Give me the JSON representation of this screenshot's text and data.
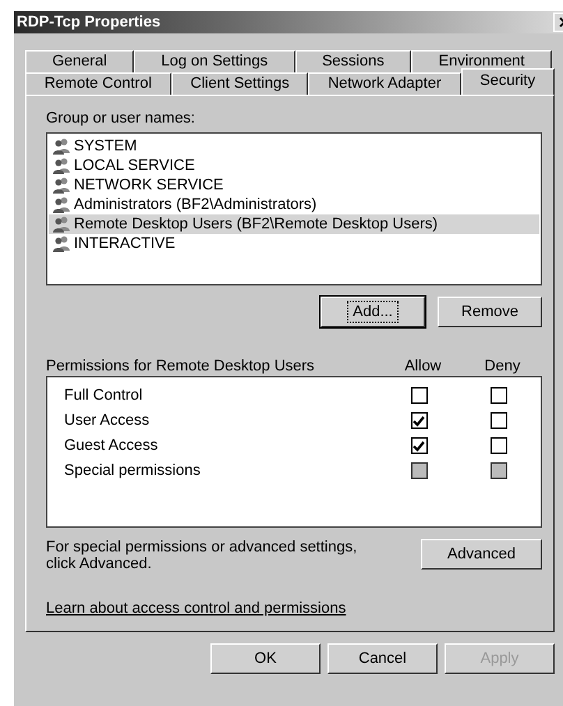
{
  "window": {
    "title": "RDP-Tcp Properties"
  },
  "tab_rows": [
    [
      {
        "label": "General",
        "selected": false
      },
      {
        "label": "Log on Settings",
        "selected": false
      },
      {
        "label": "Sessions",
        "selected": false
      },
      {
        "label": "Environment",
        "selected": false
      }
    ],
    [
      {
        "label": "Remote Control",
        "selected": false
      },
      {
        "label": "Client Settings",
        "selected": false
      },
      {
        "label": "Network Adapter",
        "selected": false
      },
      {
        "label": "Security",
        "selected": true
      }
    ]
  ],
  "groups": {
    "label": "Group or user names:",
    "items": [
      {
        "name": "SYSTEM",
        "selected": false
      },
      {
        "name": "LOCAL SERVICE",
        "selected": false
      },
      {
        "name": "NETWORK SERVICE",
        "selected": false
      },
      {
        "name": "Administrators (BF2\\Administrators)",
        "selected": false
      },
      {
        "name": "Remote Desktop Users (BF2\\Remote Desktop Users)",
        "selected": true
      },
      {
        "name": "INTERACTIVE",
        "selected": false
      }
    ],
    "buttons": [
      {
        "label": "Add...",
        "focused": true
      },
      {
        "label": "Remove",
        "focused": false
      }
    ]
  },
  "permissions": {
    "label": "Permissions for Remote Desktop Users",
    "columns": [
      "Allow",
      "Deny"
    ],
    "rows": [
      {
        "name": "Full Control",
        "allow": false,
        "deny": false,
        "disabled": false
      },
      {
        "name": "User Access",
        "allow": true,
        "deny": false,
        "disabled": false
      },
      {
        "name": "Guest Access",
        "allow": true,
        "deny": false,
        "disabled": false
      },
      {
        "name": "Special permissions",
        "allow": false,
        "deny": false,
        "disabled": true
      }
    ]
  },
  "advanced": {
    "text": "For special permissions or advanced settings, click Advanced.",
    "button": "Advanced"
  },
  "link": "Learn about access control and permissions",
  "buttons": [
    {
      "label": "OK",
      "disabled": false
    },
    {
      "label": "Cancel",
      "disabled": false
    },
    {
      "label": "Apply",
      "disabled": true
    }
  ]
}
